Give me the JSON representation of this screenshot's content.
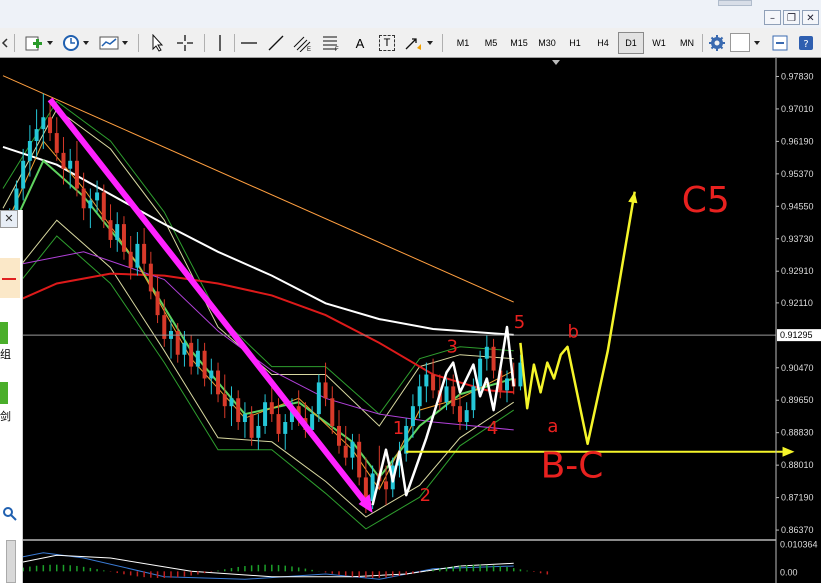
{
  "toolbar": {
    "timeframes": [
      {
        "label": "M1",
        "active": false
      },
      {
        "label": "M5",
        "active": false
      },
      {
        "label": "M15",
        "active": false
      },
      {
        "label": "M30",
        "active": false
      },
      {
        "label": "H1",
        "active": false
      },
      {
        "label": "H4",
        "active": false
      },
      {
        "label": "D1",
        "active": true
      },
      {
        "label": "W1",
        "active": false
      },
      {
        "label": "MN",
        "active": false
      }
    ],
    "text_tool_label": "A",
    "label_tool_label": "T"
  },
  "side_panel": {
    "chars": [
      "组",
      "剑"
    ]
  },
  "chart_data": {
    "type": "candlestick",
    "price_axis": {
      "ticks": [
        "0.97830",
        "0.97010",
        "0.96190",
        "0.95370",
        "0.94550",
        "0.93730",
        "0.92910",
        "0.92110",
        "0.90470",
        "0.89650",
        "0.88830",
        "0.88010",
        "0.87190",
        "0.86370"
      ],
      "range": [
        0.8622,
        0.9812
      ],
      "current_price": "0.91295",
      "current_value": 0.91295
    },
    "oscillator": {
      "ticks": [
        "0.010364",
        "0.00"
      ],
      "range": [
        -0.004,
        0.011
      ]
    },
    "candles": [
      [
        0.938,
        0.941,
        0.934,
        0.937
      ],
      [
        0.937,
        0.945,
        0.935,
        0.943
      ],
      [
        0.943,
        0.952,
        0.94,
        0.95
      ],
      [
        0.95,
        0.96,
        0.947,
        0.957
      ],
      [
        0.957,
        0.966,
        0.953,
        0.962
      ],
      [
        0.962,
        0.97,
        0.958,
        0.965
      ],
      [
        0.965,
        0.974,
        0.96,
        0.968
      ],
      [
        0.968,
        0.972,
        0.962,
        0.964
      ],
      [
        0.964,
        0.968,
        0.957,
        0.959
      ],
      [
        0.959,
        0.963,
        0.951,
        0.955
      ],
      [
        0.955,
        0.96,
        0.95,
        0.957
      ],
      [
        0.957,
        0.962,
        0.948,
        0.95
      ],
      [
        0.95,
        0.954,
        0.942,
        0.945
      ],
      [
        0.945,
        0.95,
        0.94,
        0.947
      ],
      [
        0.947,
        0.952,
        0.944,
        0.949
      ],
      [
        0.949,
        0.951,
        0.94,
        0.942
      ],
      [
        0.942,
        0.946,
        0.935,
        0.937
      ],
      [
        0.937,
        0.944,
        0.934,
        0.941
      ],
      [
        0.941,
        0.943,
        0.932,
        0.934
      ],
      [
        0.934,
        0.938,
        0.927,
        0.93
      ],
      [
        0.93,
        0.939,
        0.928,
        0.936
      ],
      [
        0.936,
        0.94,
        0.929,
        0.931
      ],
      [
        0.931,
        0.934,
        0.922,
        0.924
      ],
      [
        0.924,
        0.928,
        0.916,
        0.918
      ],
      [
        0.918,
        0.922,
        0.91,
        0.912
      ],
      [
        0.912,
        0.917,
        0.907,
        0.914
      ],
      [
        0.914,
        0.916,
        0.906,
        0.908
      ],
      [
        0.908,
        0.914,
        0.905,
        0.911
      ],
      [
        0.911,
        0.913,
        0.903,
        0.905
      ],
      [
        0.905,
        0.912,
        0.903,
        0.909
      ],
      [
        0.909,
        0.911,
        0.9,
        0.902
      ],
      [
        0.902,
        0.907,
        0.898,
        0.904
      ],
      [
        0.904,
        0.906,
        0.896,
        0.898
      ],
      [
        0.898,
        0.903,
        0.892,
        0.895
      ],
      [
        0.895,
        0.9,
        0.89,
        0.897
      ],
      [
        0.897,
        0.899,
        0.889,
        0.891
      ],
      [
        0.891,
        0.896,
        0.887,
        0.893
      ],
      [
        0.893,
        0.895,
        0.885,
        0.887
      ],
      [
        0.887,
        0.893,
        0.884,
        0.89
      ],
      [
        0.89,
        0.898,
        0.888,
        0.896
      ],
      [
        0.896,
        0.9,
        0.891,
        0.893
      ],
      [
        0.893,
        0.897,
        0.886,
        0.888
      ],
      [
        0.888,
        0.893,
        0.884,
        0.891
      ],
      [
        0.891,
        0.897,
        0.889,
        0.895
      ],
      [
        0.895,
        0.899,
        0.89,
        0.892
      ],
      [
        0.892,
        0.896,
        0.887,
        0.889
      ],
      [
        0.889,
        0.895,
        0.887,
        0.893
      ],
      [
        0.893,
        0.903,
        0.891,
        0.901
      ],
      [
        0.901,
        0.906,
        0.895,
        0.897
      ],
      [
        0.897,
        0.9,
        0.888,
        0.89
      ],
      [
        0.89,
        0.894,
        0.883,
        0.885
      ],
      [
        0.885,
        0.89,
        0.88,
        0.882
      ],
      [
        0.882,
        0.888,
        0.879,
        0.886
      ],
      [
        0.886,
        0.888,
        0.875,
        0.877
      ],
      [
        0.877,
        0.882,
        0.868,
        0.871
      ],
      [
        0.871,
        0.88,
        0.869,
        0.878
      ],
      [
        0.878,
        0.885,
        0.874,
        0.876
      ],
      [
        0.876,
        0.88,
        0.87,
        0.874
      ],
      [
        0.874,
        0.882,
        0.872,
        0.88
      ],
      [
        0.88,
        0.886,
        0.877,
        0.883
      ],
      [
        0.883,
        0.892,
        0.881,
        0.89
      ],
      [
        0.89,
        0.898,
        0.887,
        0.895
      ],
      [
        0.895,
        0.903,
        0.892,
        0.9
      ],
      [
        0.9,
        0.906,
        0.896,
        0.903
      ],
      [
        0.903,
        0.907,
        0.897,
        0.899
      ],
      [
        0.899,
        0.903,
        0.894,
        0.896
      ],
      [
        0.896,
        0.902,
        0.894,
        0.9
      ],
      [
        0.9,
        0.903,
        0.893,
        0.895
      ],
      [
        0.895,
        0.898,
        0.889,
        0.891
      ],
      [
        0.891,
        0.896,
        0.889,
        0.894
      ],
      [
        0.894,
        0.902,
        0.892,
        0.9
      ],
      [
        0.9,
        0.909,
        0.898,
        0.907
      ],
      [
        0.907,
        0.913,
        0.904,
        0.91
      ],
      [
        0.91,
        0.912,
        0.902,
        0.904
      ],
      [
        0.904,
        0.906,
        0.897,
        0.899
      ],
      [
        0.899,
        0.904,
        0.896,
        0.902
      ],
      [
        0.902,
        0.906,
        0.898,
        0.9
      ],
      [
        0.9,
        0.908,
        0.899,
        0.906
      ]
    ],
    "moving_averages": [
      {
        "color": "#ff9f40",
        "width": 1,
        "points": [
          [
            0,
            0.9785
          ],
          [
            76,
            0.9213
          ]
        ]
      },
      {
        "color": "#ffffff",
        "width": 2,
        "points": [
          [
            0,
            0.9605
          ],
          [
            8,
            0.956
          ],
          [
            16,
            0.9485
          ],
          [
            24,
            0.941
          ],
          [
            32,
            0.934
          ],
          [
            40,
            0.928
          ],
          [
            48,
            0.921
          ],
          [
            56,
            0.917
          ],
          [
            64,
            0.9145
          ],
          [
            76,
            0.913
          ]
        ]
      },
      {
        "color": "#dd1a1a",
        "width": 2,
        "points": [
          [
            0,
            0.92
          ],
          [
            8,
            0.926
          ],
          [
            16,
            0.9285
          ],
          [
            24,
            0.928
          ],
          [
            32,
            0.926
          ],
          [
            40,
            0.923
          ],
          [
            48,
            0.918
          ],
          [
            56,
            0.911
          ],
          [
            64,
            0.903
          ],
          [
            72,
            0.899
          ],
          [
            76,
            0.8985
          ]
        ]
      },
      {
        "color": "#b040d8",
        "width": 1,
        "points": [
          [
            0,
            0.93
          ],
          [
            12,
            0.934
          ],
          [
            24,
            0.927
          ],
          [
            32,
            0.914
          ],
          [
            40,
            0.904
          ],
          [
            48,
            0.897
          ],
          [
            56,
            0.893
          ],
          [
            64,
            0.891
          ],
          [
            76,
            0.889
          ]
        ]
      },
      {
        "color": "#5fd35f",
        "width": 2,
        "points": [
          [
            0,
            0.935
          ],
          [
            6,
            0.957
          ],
          [
            12,
            0.948
          ],
          [
            20,
            0.931
          ],
          [
            28,
            0.909
          ],
          [
            36,
            0.893
          ],
          [
            44,
            0.896
          ],
          [
            52,
            0.886
          ],
          [
            56,
            0.877
          ],
          [
            62,
            0.89
          ],
          [
            68,
            0.898
          ],
          [
            76,
            0.902
          ]
        ]
      },
      {
        "color": "#f0a030",
        "width": 1,
        "points": [
          [
            0,
            0.939
          ],
          [
            6,
            0.962
          ],
          [
            12,
            0.95
          ],
          [
            20,
            0.931
          ],
          [
            28,
            0.907
          ],
          [
            36,
            0.892
          ],
          [
            44,
            0.897
          ],
          [
            52,
            0.884
          ],
          [
            56,
            0.874
          ],
          [
            62,
            0.894
          ],
          [
            68,
            0.897
          ],
          [
            76,
            0.904
          ]
        ]
      }
    ],
    "bands": [
      {
        "color": "#2e9e2e",
        "points": [
          [
            0,
            0.95
          ],
          [
            8,
            0.972
          ],
          [
            16,
            0.962
          ],
          [
            24,
            0.944
          ],
          [
            32,
            0.918
          ],
          [
            40,
            0.905
          ],
          [
            48,
            0.905
          ],
          [
            56,
            0.893
          ],
          [
            62,
            0.907
          ],
          [
            68,
            0.91
          ],
          [
            76,
            0.909
          ]
        ]
      },
      {
        "color": "#2e9e2e",
        "points": [
          [
            0,
            0.921
          ],
          [
            8,
            0.938
          ],
          [
            16,
            0.926
          ],
          [
            24,
            0.906
          ],
          [
            32,
            0.884
          ],
          [
            40,
            0.884
          ],
          [
            48,
            0.873
          ],
          [
            54,
            0.864
          ],
          [
            62,
            0.872
          ],
          [
            68,
            0.885
          ],
          [
            76,
            0.894
          ]
        ]
      },
      {
        "color": "#d8d8a0",
        "points": [
          [
            0,
            0.945
          ],
          [
            8,
            0.97
          ],
          [
            16,
            0.96
          ],
          [
            24,
            0.942
          ],
          [
            32,
            0.915
          ],
          [
            40,
            0.903
          ],
          [
            48,
            0.903
          ],
          [
            56,
            0.89
          ],
          [
            62,
            0.905
          ],
          [
            68,
            0.908
          ],
          [
            76,
            0.907
          ]
        ]
      },
      {
        "color": "#d8d8a0",
        "points": [
          [
            0,
            0.925
          ],
          [
            8,
            0.942
          ],
          [
            16,
            0.93
          ],
          [
            24,
            0.909
          ],
          [
            32,
            0.887
          ],
          [
            40,
            0.886
          ],
          [
            48,
            0.876
          ],
          [
            54,
            0.867
          ],
          [
            62,
            0.875
          ],
          [
            68,
            0.887
          ],
          [
            76,
            0.896
          ]
        ]
      }
    ],
    "oscillator_series": [
      {
        "color": "#3a7bd5",
        "points": [
          [
            0,
            0.004
          ],
          [
            6,
            0.007
          ],
          [
            12,
            0.005
          ],
          [
            24,
            -0.002
          ],
          [
            36,
            -0.003
          ],
          [
            48,
            -0.001
          ],
          [
            56,
            -0.003
          ],
          [
            64,
            0.001
          ],
          [
            76,
            0.002
          ]
        ]
      },
      {
        "color": "#ffffff",
        "points": [
          [
            0,
            0.002
          ],
          [
            8,
            0.006
          ],
          [
            16,
            0.005
          ],
          [
            28,
            0.0
          ],
          [
            40,
            -0.002
          ],
          [
            52,
            -0.002
          ],
          [
            60,
            -0.001
          ],
          [
            68,
            0.002
          ],
          [
            76,
            0.003
          ]
        ]
      }
    ],
    "annotations": {
      "wave_labels": [
        {
          "text": "1",
          "bar": 58,
          "price": 0.888,
          "color": "#e8211f"
        },
        {
          "text": "2",
          "bar": 62,
          "price": 0.871,
          "color": "#e8211f"
        },
        {
          "text": "3",
          "bar": 66,
          "price": 0.9085,
          "color": "#e8211f"
        },
        {
          "text": "4",
          "bar": 72,
          "price": 0.888,
          "color": "#e8211f"
        },
        {
          "text": "5",
          "bar": 76,
          "price": 0.9148,
          "color": "#e8211f"
        },
        {
          "text": "a",
          "bar": 81,
          "price": 0.8885,
          "color": "#e8211f"
        },
        {
          "text": "b",
          "bar": 84,
          "price": 0.9123,
          "color": "#e8211f"
        },
        {
          "text": "B-C",
          "bar": 80,
          "price": 0.877,
          "color": "#e8211f"
        },
        {
          "text": "C5",
          "bar": 101,
          "price": 0.944,
          "color": "#e8211f"
        }
      ],
      "magenta_arrow": [
        [
          7,
          0.9725
        ],
        [
          55,
          0.868
        ]
      ],
      "white_waves": [
        [
          55,
          0.87
        ],
        [
          57,
          0.884
        ],
        [
          58,
          0.876
        ],
        [
          59,
          0.8835
        ],
        [
          60,
          0.8725
        ],
        [
          63,
          0.887
        ],
        [
          66,
          0.9035
        ],
        [
          67,
          0.906
        ],
        [
          68,
          0.8985
        ],
        [
          70,
          0.9055
        ],
        [
          71,
          0.8975
        ],
        [
          72,
          0.902
        ],
        [
          73,
          0.894
        ],
        [
          75,
          0.915
        ],
        [
          76,
          0.9
        ]
      ],
      "yellow_waves": [
        [
          77,
          0.911
        ],
        [
          78,
          0.8945
        ],
        [
          79,
          0.9055
        ],
        [
          80,
          0.8985
        ],
        [
          81,
          0.906
        ],
        [
          82,
          0.902
        ],
        [
          83,
          0.908
        ],
        [
          84,
          0.91
        ],
        [
          87,
          0.8855
        ],
        [
          90,
          0.909
        ],
        [
          94,
          0.9492
        ]
      ],
      "yellow_hline": {
        "price": 0.8835,
        "from_bar": 60,
        "to_bar": 116
      }
    }
  }
}
